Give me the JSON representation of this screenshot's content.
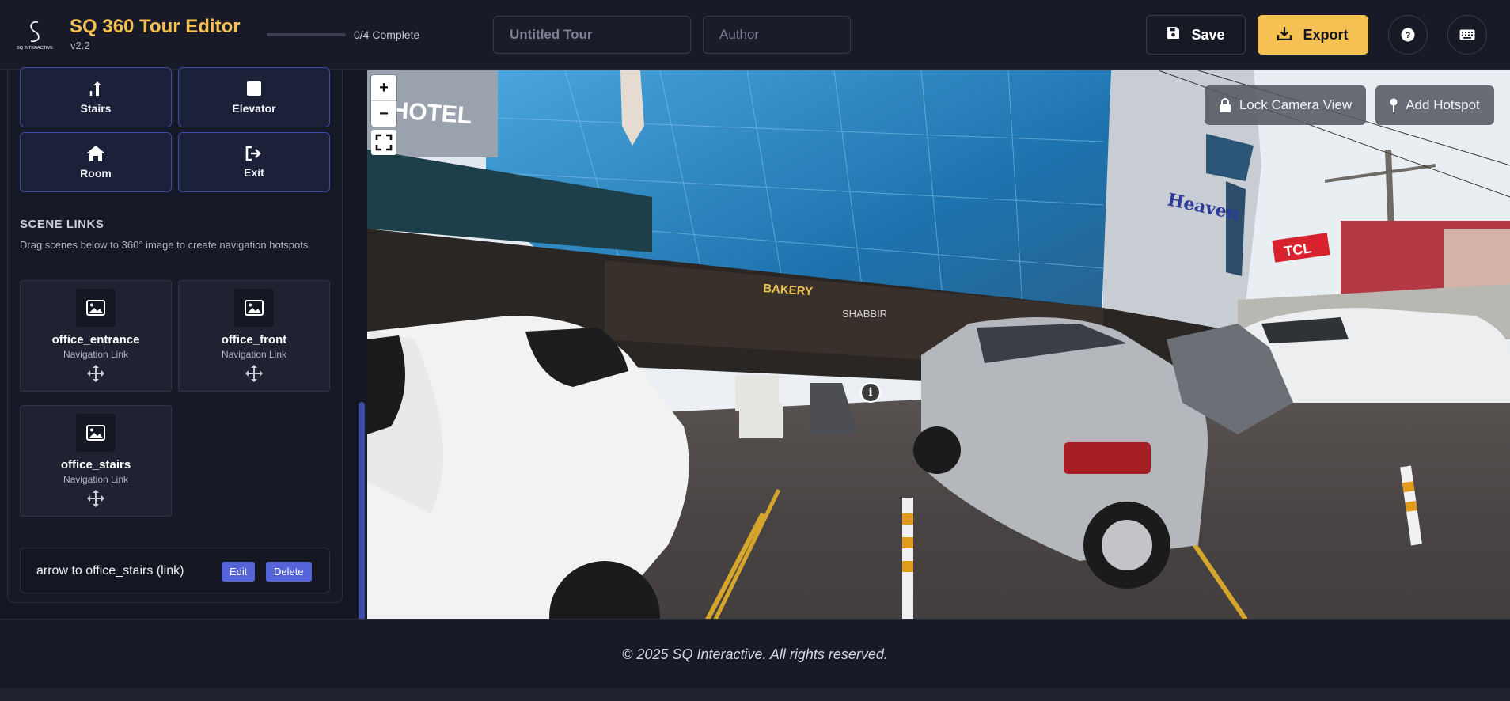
{
  "app": {
    "title": "SQ 360 Tour Editor",
    "version": "v2.2",
    "logo_text": "SQ INTERACTIVE",
    "progress_text": "0/4 Complete",
    "progress_fraction": 0
  },
  "header": {
    "tour_title_placeholder": "Untitled Tour",
    "author_placeholder": "Author",
    "save_label": "Save",
    "export_label": "Export"
  },
  "hotspot_types": [
    {
      "label": "Stairs",
      "icon": "stairs-icon"
    },
    {
      "label": "Elevator",
      "icon": "elevator-icon"
    },
    {
      "label": "Room",
      "icon": "home-icon"
    },
    {
      "label": "Exit",
      "icon": "exit-icon"
    }
  ],
  "scene_links": {
    "title": "SCENE LINKS",
    "description": "Drag scenes below to 360° image to create navigation hotspots",
    "scenes": [
      {
        "name": "office_entrance",
        "type": "Navigation Link"
      },
      {
        "name": "office_front",
        "type": "Navigation Link"
      },
      {
        "name": "office_stairs",
        "type": "Navigation Link"
      }
    ]
  },
  "hotspot_list": [
    {
      "label": "arrow to office_stairs (link)",
      "edit": "Edit",
      "delete": "Delete"
    }
  ],
  "viewer": {
    "zoom_in": "+",
    "zoom_out": "−",
    "lock_camera_label": "Lock Camera View",
    "add_hotspot_label": "Add Hotspot",
    "signs": {
      "hotel": "HOTEL",
      "heaven": "Heaven",
      "tcl": "TCL",
      "bakery": "BAKERY",
      "shabbir": "SHABBIR"
    }
  },
  "footer": {
    "copyright": "© 2025 SQ Interactive. All rights reserved."
  },
  "colors": {
    "accent": "#f4c152",
    "button_blue": "#5664d9",
    "type_border": "#3d4ca6"
  }
}
